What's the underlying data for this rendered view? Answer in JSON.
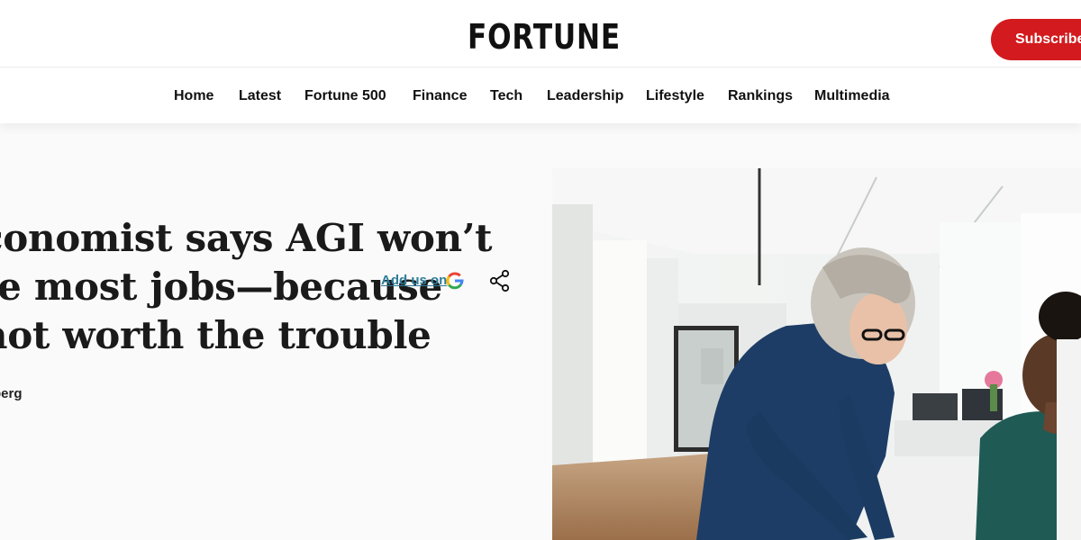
{
  "brand": {
    "logo": "FORTUNE"
  },
  "header": {
    "subscribe_label": "Subscribe"
  },
  "nav": {
    "items": [
      {
        "label": "Home"
      },
      {
        "label": "Latest"
      },
      {
        "label": "Fortune 500"
      },
      {
        "label": "Finance"
      },
      {
        "label": "Tech"
      },
      {
        "label": "Leadership"
      },
      {
        "label": "Lifestyle"
      },
      {
        "label": "Rankings"
      },
      {
        "label": "Multimedia"
      }
    ]
  },
  "article": {
    "headline_lines": [
      "conomist says AGI won’t",
      "te most jobs—because",
      "not worth the trouble"
    ],
    "byline": "berg",
    "add_us_label": "Add us on",
    "google_icon": "google-icon",
    "share_icon": "share-icon"
  },
  "colors": {
    "subscribe_bg": "#d31a1e",
    "link": "#2d7d9a",
    "article_bg": "#fafafa"
  }
}
